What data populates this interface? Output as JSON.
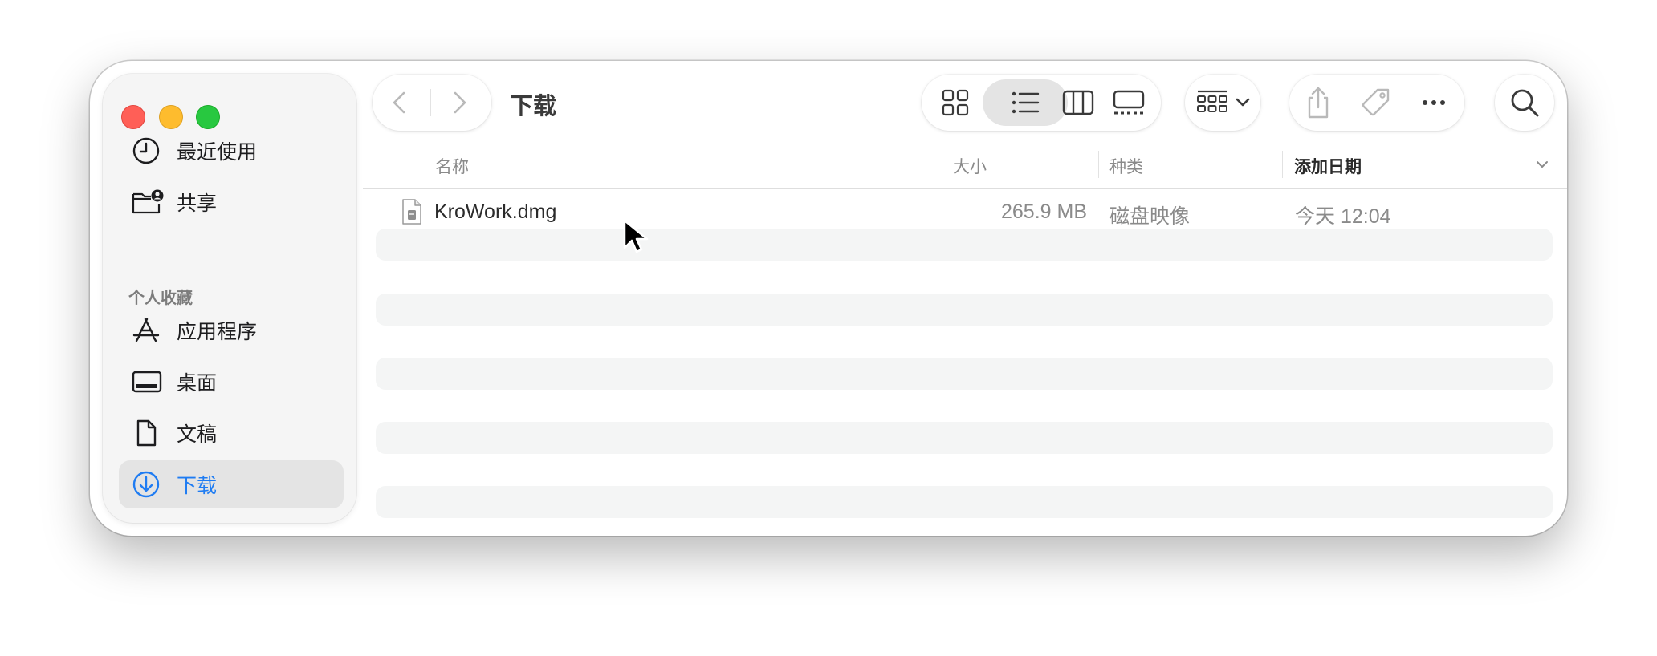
{
  "window": {
    "title": "下载"
  },
  "sidebar": {
    "recents_label": "最近使用",
    "shared_label": "共享",
    "section_label": "个人收藏",
    "favorites": [
      {
        "label": "应用程序",
        "icon": "applications-icon"
      },
      {
        "label": "桌面",
        "icon": "desktop-icon"
      },
      {
        "label": "文稿",
        "icon": "document-icon"
      },
      {
        "label": "下载",
        "icon": "download-icon",
        "selected": true
      }
    ]
  },
  "toolbar": {
    "view_modes": [
      "icon-view",
      "list-view",
      "column-view",
      "gallery-view"
    ],
    "active_view": "list-view"
  },
  "columns": {
    "name": "名称",
    "size": "大小",
    "kind": "种类",
    "date_added": "添加日期",
    "sort_column": "添加日期",
    "sort_order": "descending"
  },
  "files": [
    {
      "name": "KroWork.dmg",
      "size": "265.9 MB",
      "kind": "磁盘映像",
      "date_added": "今天 12:04",
      "icon": "disk-image-icon"
    }
  ],
  "colors": {
    "accent": "#1f7cf2",
    "close": "#ff5f57",
    "minimize": "#febc2e",
    "zoom": "#28c840"
  }
}
